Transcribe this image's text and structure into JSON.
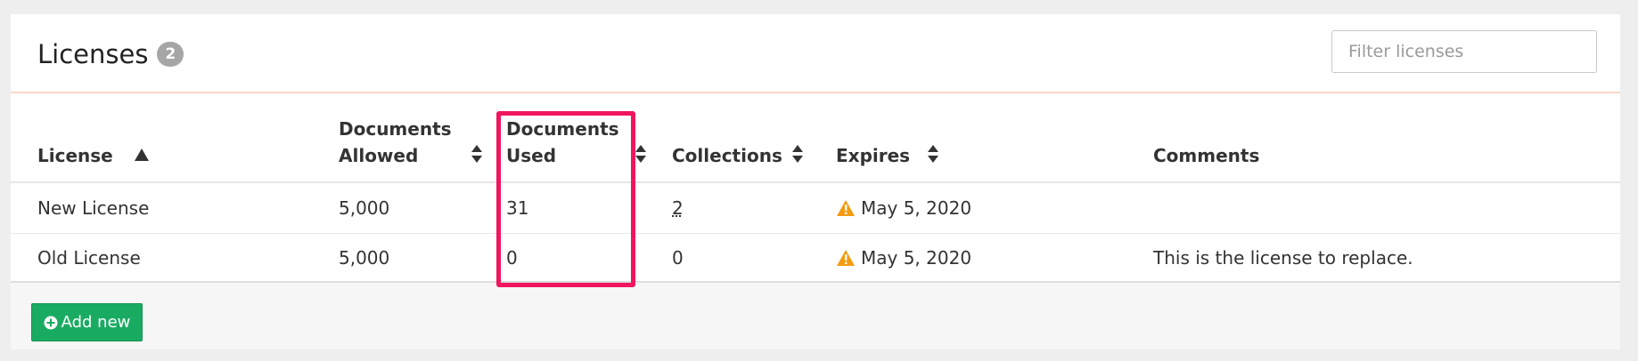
{
  "header": {
    "title": "Licenses",
    "count": "2",
    "filter_placeholder": "Filter licenses"
  },
  "table": {
    "columns": {
      "license": "License",
      "documents_allowed_l1": "Documents",
      "documents_allowed_l2": "Allowed",
      "documents_used_l1": "Documents",
      "documents_used_l2": "Used",
      "collections": "Collections",
      "expires": "Expires",
      "comments": "Comments"
    },
    "sort": {
      "column": "license",
      "direction": "ascending"
    },
    "rows": [
      {
        "license": "New License",
        "documents_allowed": "5,000",
        "documents_used": "31",
        "collections": "2",
        "expires": "May 5, 2020",
        "comments": ""
      },
      {
        "license": "Old License",
        "documents_allowed": "5,000",
        "documents_used": "0",
        "collections": "0",
        "expires": "May 5, 2020",
        "comments": "This is the license to replace."
      }
    ]
  },
  "footer": {
    "add_label": "Add new"
  },
  "colors": {
    "accent_green": "#1aab62",
    "warning_orange": "#f39c12",
    "highlight_pink": "#f0155f",
    "header_rule": "#f8d6c8"
  },
  "icons": {
    "sort_asc": "triangle-up-icon",
    "sort_both": "sort-icon",
    "warning": "warning-icon",
    "add": "plus-circle-icon"
  }
}
